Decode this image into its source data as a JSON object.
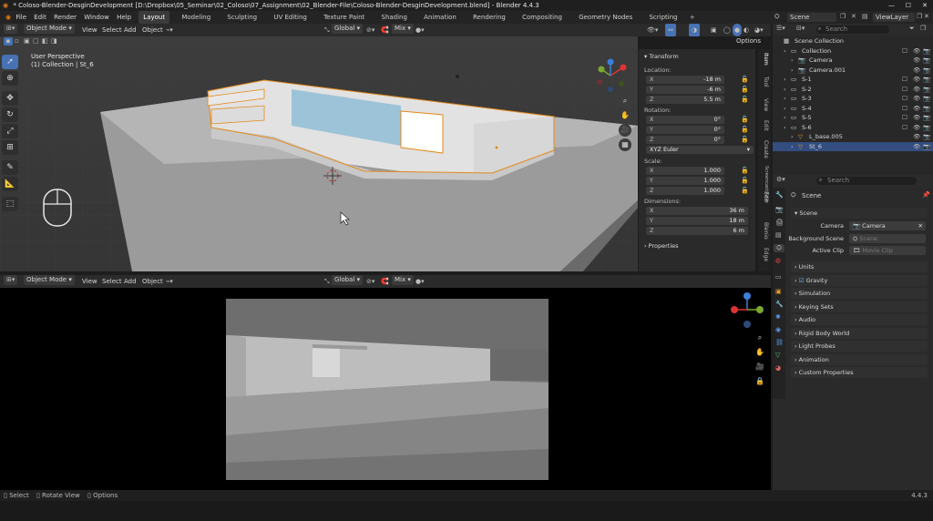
{
  "window": {
    "title": "* Coloso-Blender-DesginDevelopment [D:\\Dropbox\\05_Seminar\\02_Coloso\\07_Assignment\\02_Blender-File\\Coloso-Blender-DesginDevelopment.blend] - Blender 4.4.3",
    "controls": [
      "—",
      "☐",
      "✕"
    ]
  },
  "menu": [
    "File",
    "Edit",
    "Render",
    "Window",
    "Help"
  ],
  "workspaces": [
    "Layout",
    "Modeling",
    "Sculpting",
    "UV Editing",
    "Texture Paint",
    "Shading",
    "Animation",
    "Rendering",
    "Compositing",
    "Geometry Nodes",
    "Scripting"
  ],
  "active_workspace": "Layout",
  "top_right": {
    "scene": "Scene",
    "view_layer": "ViewLayer"
  },
  "viewport_top": {
    "mode": "Object Mode",
    "menus": [
      "View",
      "Select",
      "Add",
      "Object"
    ],
    "orientation": "Global",
    "proportional": "Mix",
    "options_label": "Options",
    "overlay_text": {
      "perspective": "User Perspective",
      "collection": "(1) Collection | St_6"
    }
  },
  "npanel": {
    "transform_header": "Transform",
    "location_label": "Location:",
    "location": [
      {
        "k": "X",
        "v": "-18 m"
      },
      {
        "k": "Y",
        "v": "-6 m"
      },
      {
        "k": "Z",
        "v": "5.5 m"
      }
    ],
    "rotation_label": "Rotation:",
    "rotation": [
      {
        "k": "X",
        "v": "0°"
      },
      {
        "k": "Y",
        "v": "0°"
      },
      {
        "k": "Z",
        "v": "0°"
      }
    ],
    "rotation_mode": "XYZ Euler",
    "scale_label": "Scale:",
    "scale": [
      {
        "k": "X",
        "v": "1.000"
      },
      {
        "k": "Y",
        "v": "1.000"
      },
      {
        "k": "Z",
        "v": "1.000"
      }
    ],
    "dimensions_label": "Dimensions:",
    "dimensions": [
      {
        "k": "X",
        "v": "36 m"
      },
      {
        "k": "Y",
        "v": "18 m"
      },
      {
        "k": "Z",
        "v": "6 m"
      }
    ],
    "properties_header": "Properties"
  },
  "ntabs": [
    "Item",
    "Tool",
    "View",
    "Edit",
    "Create",
    "Screencast Keys",
    "Edit",
    "Blenio",
    "Edge"
  ],
  "viewport_bottom": {
    "mode": "Object Mode",
    "menus": [
      "View",
      "Select",
      "Add",
      "Object"
    ],
    "orientation": "Global",
    "proportional": "Mix"
  },
  "outliner": {
    "search_placeholder": "Search",
    "rows": [
      {
        "label": "Scene Collection",
        "indent": 0,
        "sel": false
      },
      {
        "label": "Collection",
        "indent": 1,
        "sel": false
      },
      {
        "label": "Camera",
        "indent": 2,
        "sel": false
      },
      {
        "label": "Camera.001",
        "indent": 2,
        "sel": false
      },
      {
        "label": "S-1",
        "indent": 1,
        "sel": false
      },
      {
        "label": "S-2",
        "indent": 1,
        "sel": false
      },
      {
        "label": "S-3",
        "indent": 1,
        "sel": false
      },
      {
        "label": "S-4",
        "indent": 1,
        "sel": false
      },
      {
        "label": "S-5",
        "indent": 1,
        "sel": false
      },
      {
        "label": "S-6",
        "indent": 1,
        "sel": false
      },
      {
        "label": "L_base.005",
        "indent": 2,
        "sel": false
      },
      {
        "label": "St_6",
        "indent": 2,
        "sel": true
      }
    ]
  },
  "properties": {
    "search_placeholder": "Search",
    "breadcrumb": "Scene",
    "scene_header": "Scene",
    "camera_label": "Camera",
    "camera_value": "Camera",
    "background_label": "Background Scene",
    "background_placeholder": "Scene",
    "clip_label": "Active Clip",
    "clip_placeholder": "Movie Clip",
    "sections": [
      "Units",
      "Gravity",
      "Simulation",
      "Keying Sets",
      "Audio",
      "Rigid Body World",
      "Light Probes",
      "Animation",
      "Custom Properties"
    ]
  },
  "statusbar": {
    "items": [
      "Select",
      "Rotate View",
      "Options"
    ],
    "version": "4.4.3"
  },
  "colors": {
    "accent": "#4772b3",
    "selection": "#334d80",
    "selected_outline": "#e5891a",
    "glass": "#88b8d6"
  }
}
